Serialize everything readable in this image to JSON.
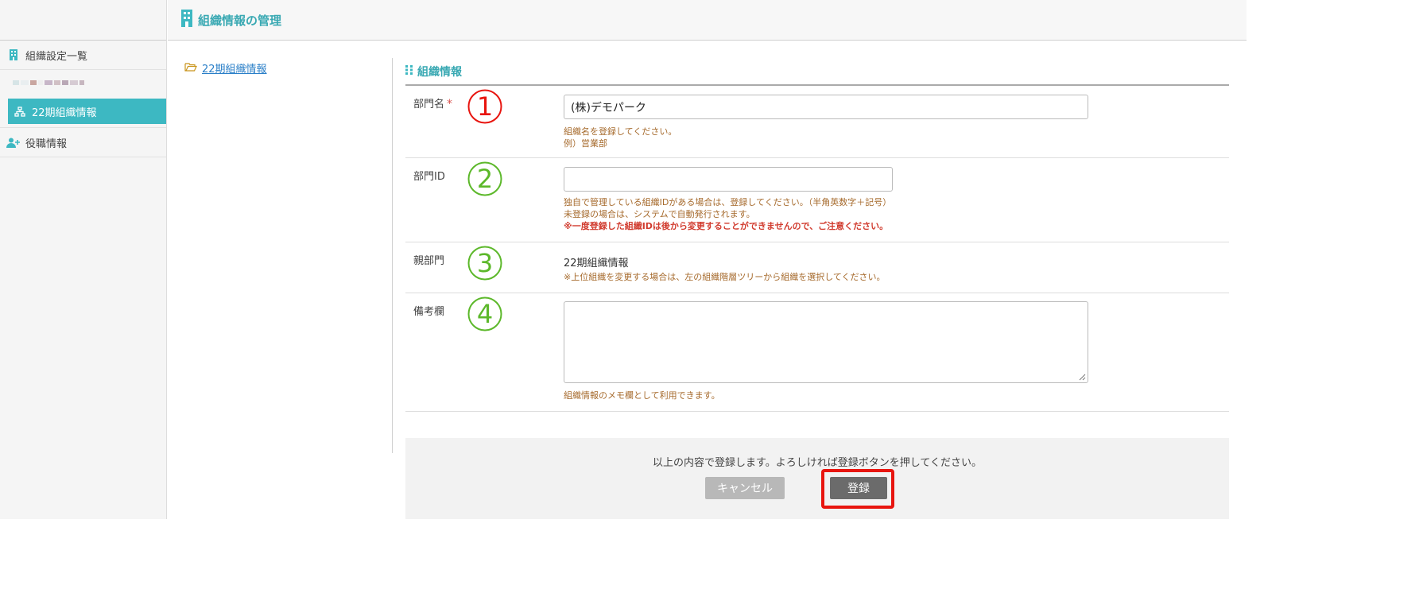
{
  "header": {
    "title": "組織情報の管理",
    "icon": "building-icon"
  },
  "sidebar": {
    "items": [
      {
        "label": "組織設定一覧",
        "icon": "building-icon"
      },
      {
        "label": "22期組織情報",
        "icon": "org-tree-icon",
        "active": true
      },
      {
        "label": "役職情報",
        "icon": "user-plus-icon"
      }
    ]
  },
  "tree": {
    "folder_label": "22期組織情報",
    "icon": "folder-open-icon"
  },
  "section": {
    "title": "組織情報",
    "icon": "grid-dots-icon"
  },
  "fields": {
    "dept_name": {
      "label": "部門名",
      "required_mark": "*",
      "number": "1",
      "value": "(株)デモパーク",
      "help1": "組織名を登録してください。",
      "help2": "例）営業部"
    },
    "dept_id": {
      "label": "部門ID",
      "number": "2",
      "value": "",
      "help1": "独自で管理している組織IDがある場合は、登録してください。（半角英数字＋記号）",
      "help2": "未登録の場合は、システムで自動発行されます。",
      "help3": "※一度登録した組織IDは後から変更することができませんので、ご注意ください。"
    },
    "parent_dept": {
      "label": "親部門",
      "number": "3",
      "value": "22期組織情報",
      "help1": "※上位組織を変更する場合は、左の組織階層ツリーから組織を選択してください。"
    },
    "notes": {
      "label": "備考欄",
      "number": "4",
      "value": "",
      "help1": "組織情報のメモ欄として利用できます。"
    }
  },
  "footer": {
    "message": "以上の内容で登録します。よろしければ登録ボタンを押してください。",
    "cancel_label": "キャンセル",
    "register_label": "登録"
  },
  "colors": {
    "accent": "#3db8c2",
    "annotation_red": "#e8150f",
    "annotation_green": "#5cb82a",
    "help_text": "#a66a2c"
  }
}
